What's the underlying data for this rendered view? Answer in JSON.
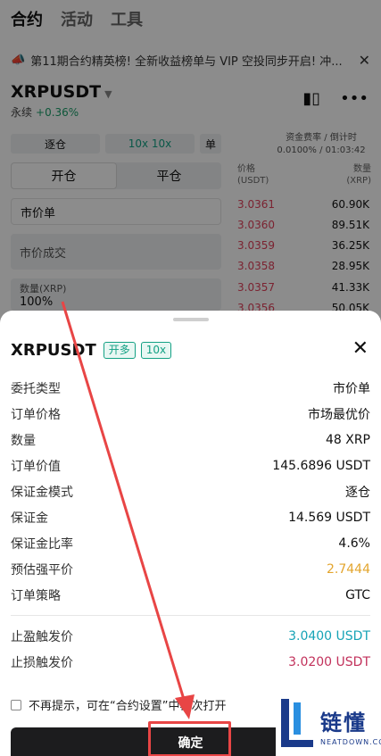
{
  "background": {
    "tabs": [
      "合约",
      "活动",
      "工具"
    ],
    "notice": "第11期合约精英榜! 全新收益榜单与 VIP 空投同步开启! 冲...",
    "pair": "XRPUSDT",
    "perp_label": "永续",
    "change_pct": "+0.36%",
    "mode_isolated": "逐仓",
    "leverage": "10x 10x",
    "single": "单",
    "funding_label": "资金费率 / 倒计时",
    "funding_value": "0.0100% / 01:03:42",
    "open_tab": "开仓",
    "close_tab": "平仓",
    "order_type": "市价单",
    "market_fill": "市价成交",
    "qty_label": "数量(XRP)",
    "qty_value": "100%",
    "ob_price_header": "价格\n(USDT)",
    "ob_qty_header": "数量\n(XRP)",
    "orderbook": [
      {
        "price": "3.0361",
        "qty": "60.90K"
      },
      {
        "price": "3.0360",
        "qty": "89.51K"
      },
      {
        "price": "3.0359",
        "qty": "36.25K"
      },
      {
        "price": "3.0358",
        "qty": "28.95K"
      },
      {
        "price": "3.0357",
        "qty": "41.33K"
      },
      {
        "price": "3.0356",
        "qty": "50.05K"
      }
    ]
  },
  "sheet": {
    "title": "XRPUSDT",
    "tag_side": "开多",
    "tag_leverage": "10x",
    "close_icon": "close-icon",
    "rows": [
      {
        "label": "委托类型",
        "value": "市价单",
        "color": "default"
      },
      {
        "label": "订单价格",
        "value": "市场最优价",
        "color": "default"
      },
      {
        "label": "数量",
        "value": "48 XRP",
        "color": "default"
      },
      {
        "label": "订单价值",
        "value": "145.6896 USDT",
        "color": "default"
      },
      {
        "label": "保证金模式",
        "value": "逐仓",
        "color": "default"
      },
      {
        "label": "保证金",
        "value": "14.569 USDT",
        "color": "default"
      },
      {
        "label": "保证金比率",
        "value": "4.6%",
        "color": "default"
      },
      {
        "label": "预估强平价",
        "value": "2.7444",
        "color": "orange"
      },
      {
        "label": "订单策略",
        "value": "GTC",
        "color": "default"
      }
    ],
    "tp_label": "止盈触发价",
    "tp_value": "3.0400 USDT",
    "sl_label": "止损触发价",
    "sl_value": "3.0200 USDT",
    "dont_show": "不再提示，可在“合约设置”中再次打开",
    "confirm_label": "确定"
  },
  "watermark": {
    "cn": "链懂",
    "en": "NEATDOWN.COM"
  },
  "colors": {
    "accent_green": "#13a184",
    "tp_color": "#16a3b6",
    "sl_color": "#c2315b",
    "liq_color": "#e3a52e",
    "arrow": "#e84545"
  }
}
